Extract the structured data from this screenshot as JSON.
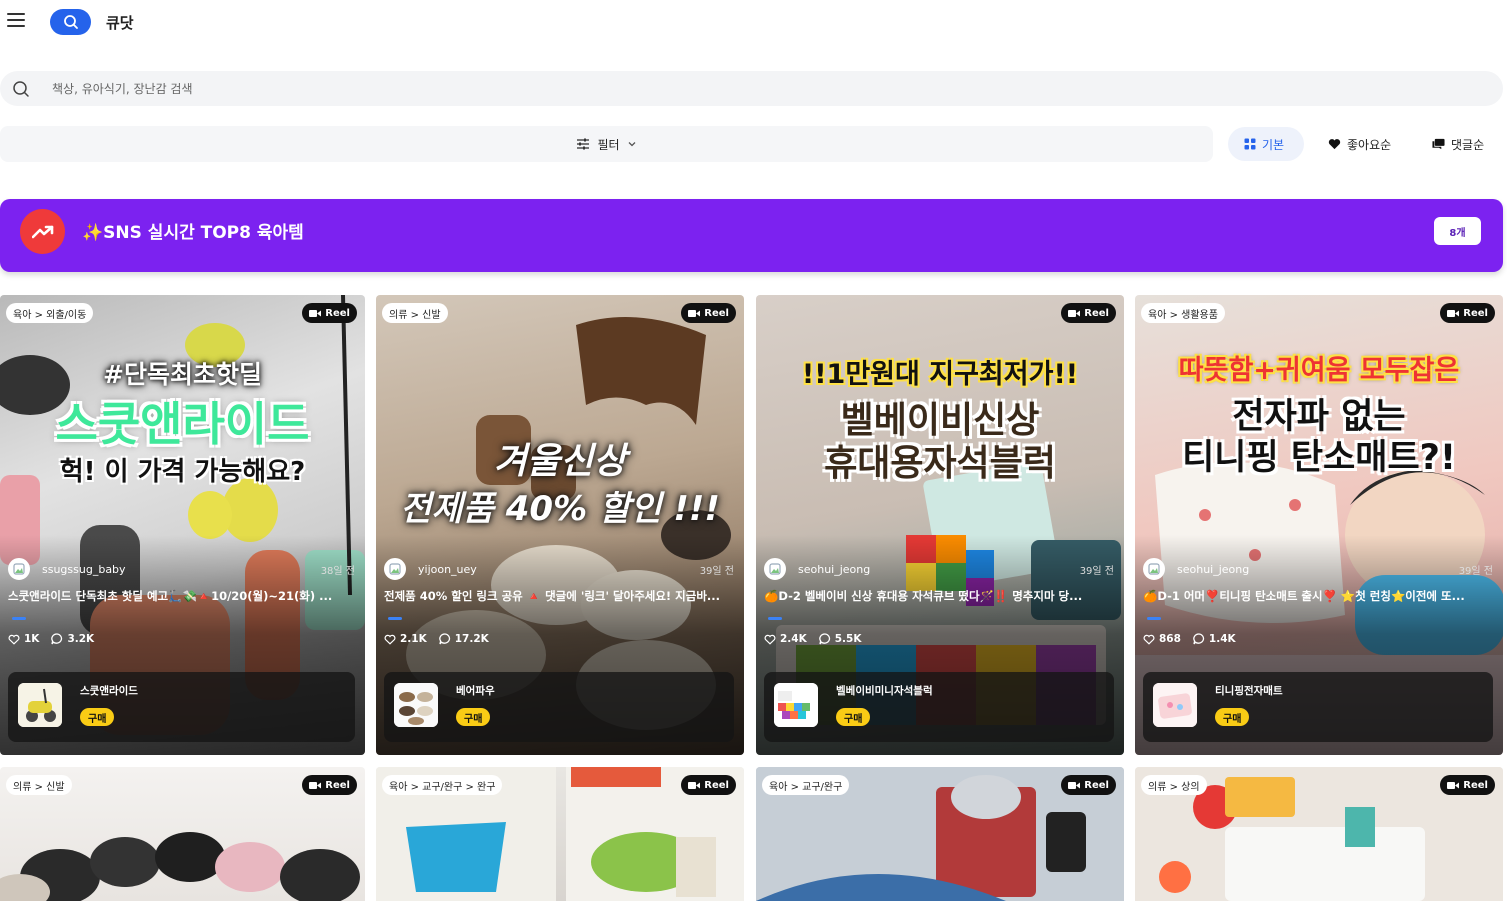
{
  "header": {
    "brand": "큐닷"
  },
  "search": {
    "placeholder": "책상, 유아식기, 장난감 검색"
  },
  "filter": {
    "label": "필터"
  },
  "sort": {
    "basic": "기본",
    "likes": "좋아요순",
    "comments": "댓글순"
  },
  "banner": {
    "title": "✨SNS 실시간 TOP8 육아템",
    "count": "8개"
  },
  "cards": [
    {
      "category": "육아 > 외출/이동",
      "reel": "Reel",
      "headline": [
        "#단독최초핫딜",
        "스쿳앤라이드",
        "헉! 이 가격 가능해요?"
      ],
      "user": "ssugssug_baby",
      "time": "38일 전",
      "desc": "스쿳앤라이드 단독최초 핫딜 예고🛴💸🔺10/20(월)~21(화) ...",
      "likes": "1K",
      "comments": "3.2K",
      "product": "스쿳앤라이드",
      "buy": "구매"
    },
    {
      "category": "의류 > 신발",
      "reel": "Reel",
      "headline": [
        "겨울신상",
        "전제품 40% 할인 !!!"
      ],
      "user": "yijoon_uey",
      "time": "39일 전",
      "desc": "전제품 40% 할인 링크 공유 🔺 댓글에 '링크' 달아주세요! 지금바...",
      "likes": "2.1K",
      "comments": "17.2K",
      "product": "베어파우",
      "buy": "구매"
    },
    {
      "category": "",
      "reel": "Reel",
      "headline": [
        "!!1만원대 지구최저가!!",
        "벨베이비신상",
        "휴대용자석블럭"
      ],
      "user": "seohui_jeong",
      "time": "39일 전",
      "desc": "🍊D-2 벨베이비 신상 휴대용 자석큐브 떴다🪄‼️ 명추지마 당...",
      "likes": "2.4K",
      "comments": "5.5K",
      "product": "벨베이비미니자석블럭",
      "buy": "구매"
    },
    {
      "category": "육아 > 생활용품",
      "reel": "Reel",
      "headline": [
        "따뜻함+귀여움 모두잡은",
        "전자파 없는",
        "티니핑 탄소매트?!"
      ],
      "user": "seohui_jeong",
      "time": "39일 전",
      "desc": "🍊D-1 어머❣️티니핑 탄소매트 출시❣️ ⭐첫 런칭⭐이전에 또...",
      "likes": "868",
      "comments": "1.4K",
      "product": "티니핑전자매트",
      "buy": "구매"
    },
    {
      "category": "의류 > 신발",
      "reel": "Reel"
    },
    {
      "category": "육아 > 교구/완구 > 완구",
      "reel": "Reel"
    },
    {
      "category": "육아 > 교구/완구",
      "reel": "Reel"
    },
    {
      "category": "의류 > 상의",
      "reel": "Reel"
    }
  ],
  "colors": {
    "accent": "#2563eb",
    "banner": "#7c22f0",
    "buy": "#facc15"
  }
}
